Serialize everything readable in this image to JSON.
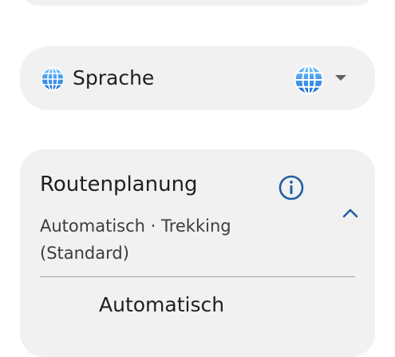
{
  "language_setting": {
    "icon": "globe-icon",
    "label": "Sprache",
    "selected_icon": "globe-icon",
    "dropdown_icon": "caret-down-icon"
  },
  "routing": {
    "title": "Routenplanung",
    "info_icon": "info-icon",
    "summary": "Automatisch · Trekking (Standard)",
    "expanded": true,
    "collapse_icon": "chevron-up-icon",
    "options": [
      {
        "label": "Automatisch"
      }
    ]
  },
  "colors": {
    "card_background": "#f1f1f1",
    "accent": "#1f5fa0",
    "globe_blue": "#2f8ff0"
  }
}
